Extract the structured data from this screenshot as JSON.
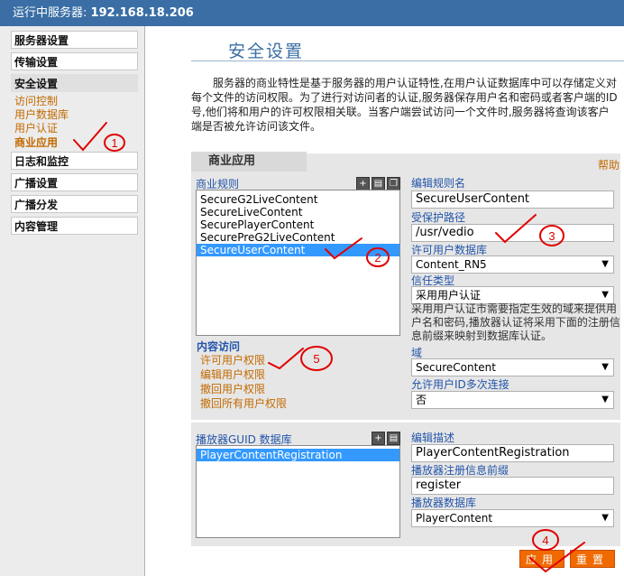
{
  "header": {
    "label": "运行中服务器:",
    "address": "192.168.18.206"
  },
  "sidebar": {
    "items": [
      {
        "label": "服务器设置"
      },
      {
        "label": "传输设置"
      },
      {
        "label": "安全设置"
      },
      {
        "label": "日志和监控"
      },
      {
        "label": "广播设置"
      },
      {
        "label": "广播分发"
      },
      {
        "label": "内容管理"
      }
    ],
    "sublinks": [
      {
        "label": "访问控制"
      },
      {
        "label": "用户数据库"
      },
      {
        "label": "用户认证"
      },
      {
        "label": "商业应用"
      }
    ]
  },
  "page": {
    "title": "安全设置",
    "intro": "服务器的商业特性是基于服务器的用户认证特性,在用户认证数据库中可以存储定义对每个文件的访问权限。为了进行对访问者的认证,服务器保存用户名和密码或者客户端的ID号,他们将和用户的许可权限相关联。当客户端尝试访问一个文件时,服务器将查询该客户端是否被允许访问该文件。"
  },
  "panel": {
    "tab": "商业应用",
    "help": "帮助",
    "rules": {
      "label": "商业规则",
      "items": [
        "SecureG2LiveContent",
        "SecureLiveContent",
        "SecurePlayerContent",
        "SecurePreG2LiveContent",
        "SecureUserContent"
      ],
      "selected": "SecureUserContent"
    },
    "edit_rule_name": {
      "label": "编辑规则名",
      "value": "SecureUserContent"
    },
    "protected_path": {
      "label": "受保护路径",
      "value": "/usr/vedio"
    },
    "user_db": {
      "label": "许可用户数据库",
      "value": "Content_RN5"
    },
    "trust_type": {
      "label": "信任类型",
      "value": "采用用户认证"
    },
    "trust_note": "采用用户认证市需要指定生效的域来提供用户名和密码,播放器认证将采用下面的注册信息前缀来映射到数据库认证。",
    "domain": {
      "label": "域",
      "value": "SecureContent"
    },
    "multi_conn": {
      "label": "允许用户ID多次连接",
      "value": "否"
    },
    "content_access": {
      "label": "内容访问",
      "links": [
        "许可用户权限",
        "编辑用户权限",
        "撤回用户权限",
        "撤回所有用户权限"
      ]
    },
    "guid_db": {
      "label": "播放器GUID 数据库",
      "items": [
        "PlayerContentRegistration"
      ],
      "selected": "PlayerContentRegistration"
    },
    "edit_desc": {
      "label": "编辑描述",
      "value": "PlayerContentRegistration"
    },
    "reg_prefix": {
      "label": "播放器注册信息前缀",
      "value": "register"
    },
    "player_db": {
      "label": "播放器数据库",
      "value": "PlayerContent"
    },
    "apply_label": "应用",
    "reset_label": "重置"
  },
  "annotations": [
    "1",
    "2",
    "3",
    "4",
    "5"
  ],
  "colors": {
    "topbar": "#3a6ea5",
    "accent": "#c36a00",
    "button": "#f06a00",
    "selection": "#3399ff",
    "annotation_red": "#e00000"
  }
}
